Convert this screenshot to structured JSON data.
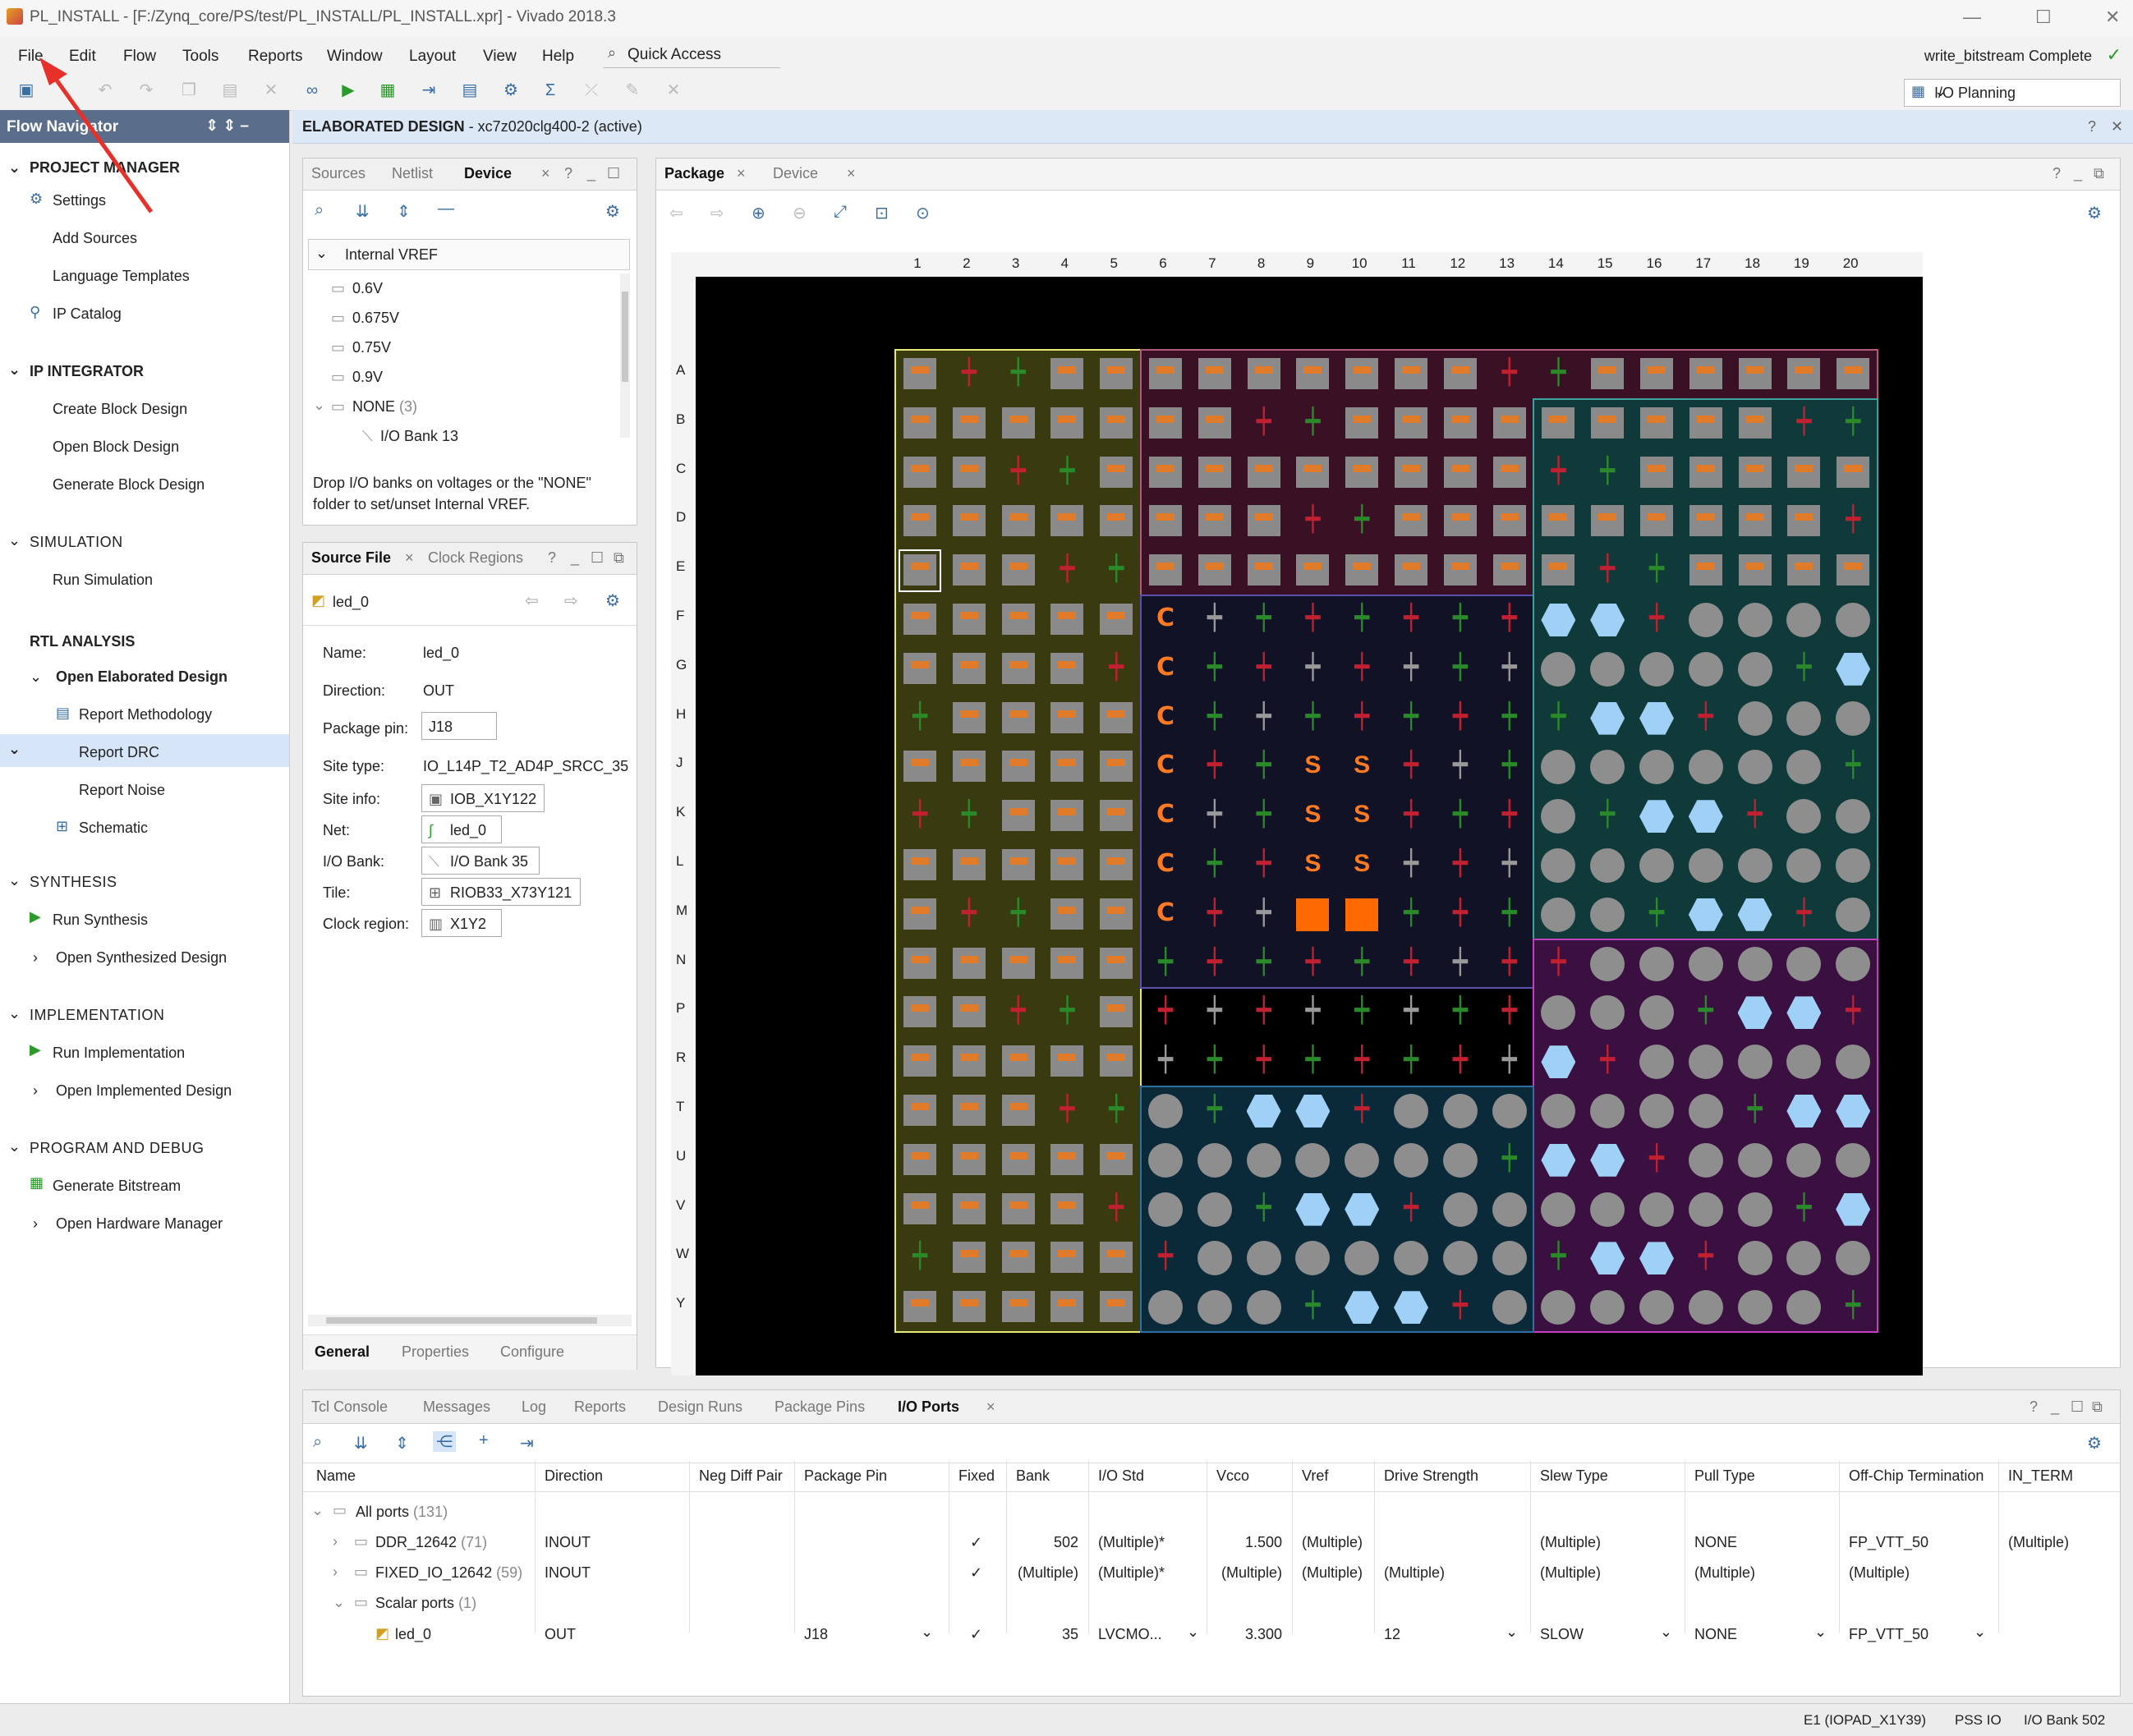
{
  "titlebar": {
    "title": "PL_INSTALL - [F:/Zynq_core/PS/test/PL_INSTALL/PL_INSTALL.xpr] - Vivado 2018.3",
    "min": "—",
    "max": "☐",
    "close": "✕"
  },
  "menubar": {
    "items": [
      "File",
      "Edit",
      "Flow",
      "Tools",
      "Reports",
      "Window",
      "Layout",
      "View",
      "Help"
    ],
    "quick_access": "Quick Access",
    "status": "write_bitstream Complete",
    "layout_select": "I/O Planning"
  },
  "flow_navigator": {
    "title": "Flow Navigator",
    "sections": [
      {
        "label": "PROJECT MANAGER",
        "items": [
          "Settings",
          "Add Sources",
          "Language Templates",
          "IP Catalog"
        ]
      },
      {
        "label": "IP INTEGRATOR",
        "items": [
          "Create Block Design",
          "Open Block Design",
          "Generate Block Design"
        ]
      },
      {
        "label": "SIMULATION",
        "items": [
          "Run Simulation"
        ]
      },
      {
        "label": "RTL ANALYSIS",
        "items": [
          "Open Elaborated Design",
          "Report Methodology",
          "Report DRC",
          "Report Noise",
          "Schematic"
        ]
      },
      {
        "label": "SYNTHESIS",
        "items": [
          "Run Synthesis",
          "Open Synthesized Design"
        ]
      },
      {
        "label": "IMPLEMENTATION",
        "items": [
          "Run Implementation",
          "Open Implemented Design"
        ]
      },
      {
        "label": "PROGRAM AND DEBUG",
        "items": [
          "Generate Bitstream",
          "Open Hardware Manager"
        ]
      }
    ]
  },
  "main_header": {
    "label": "ELABORATED DESIGN",
    "part": " - xc7z020clg400-2",
    "active": "(active)"
  },
  "device_panel": {
    "tabs": [
      "Sources",
      "Netlist",
      "Device"
    ],
    "tree_root": "Internal VREF",
    "voltages": [
      "0.6V",
      "0.675V",
      "0.75V",
      "0.9V"
    ],
    "none_folder": "NONE",
    "none_count": "(3)",
    "bank": "I/O Bank 13",
    "hint": "Drop I/O banks on voltages or the \"NONE\" folder to set/unset Internal VREF."
  },
  "source_panel": {
    "tabs": [
      "Source File",
      "Clock Regions"
    ],
    "object": "led_0",
    "rows": [
      {
        "label": "Name:",
        "value": "led_0"
      },
      {
        "label": "Direction:",
        "value": "OUT"
      },
      {
        "label": "Package pin:",
        "value": "J18"
      },
      {
        "label": "Site type:",
        "value": "IO_L14P_T2_AD4P_SRCC_35"
      },
      {
        "label": "Site info:",
        "value": "IOB_X1Y122"
      },
      {
        "label": "Net:",
        "value": "led_0"
      },
      {
        "label": "I/O Bank:",
        "value": "I/O Bank 35"
      },
      {
        "label": "Tile:",
        "value": "RIOB33_X73Y121"
      },
      {
        "label": "Clock region:",
        "value": "X1Y2"
      }
    ],
    "bottom_tabs": [
      "General",
      "Properties",
      "Configure"
    ]
  },
  "package_panel": {
    "tabs": [
      "Package",
      "Device"
    ],
    "columns": [
      "1",
      "2",
      "3",
      "4",
      "5",
      "6",
      "7",
      "8",
      "9",
      "10",
      "11",
      "12",
      "13",
      "14",
      "15",
      "16",
      "17",
      "18",
      "19",
      "20"
    ],
    "rows": [
      "A",
      "B",
      "C",
      "D",
      "E",
      "F",
      "G",
      "H",
      "J",
      "K",
      "L",
      "M",
      "N",
      "P",
      "R",
      "T",
      "U",
      "V",
      "W",
      "Y"
    ]
  },
  "io_ports": {
    "tabs": [
      "Tcl Console",
      "Messages",
      "Log",
      "Reports",
      "Design Runs",
      "Package Pins",
      "I/O Ports"
    ],
    "headers": [
      "Name",
      "Direction",
      "Neg Diff Pair",
      "Package Pin",
      "Fixed",
      "Bank",
      "I/O Std",
      "Vcco",
      "Vref",
      "Drive Strength",
      "Slew Type",
      "Pull Type",
      "Off-Chip Termination",
      "IN_TERM"
    ],
    "all_ports": "All ports",
    "all_count": "(131)",
    "rows": [
      {
        "name": "DDR_12642",
        "count": "(71)",
        "dir": "INOUT",
        "pin": "",
        "fixed": "✓",
        "bank": "502",
        "iostd": "(Multiple)*",
        "vcco": "1.500",
        "vref": "(Multiple)",
        "drive": "",
        "slew": "(Multiple)",
        "pull": "NONE",
        "term": "FP_VTT_50",
        "interm": "(Multiple)"
      },
      {
        "name": "FIXED_IO_12642",
        "count": "(59)",
        "dir": "INOUT",
        "pin": "",
        "fixed": "✓",
        "bank": "(Multiple)",
        "iostd": "(Multiple)*",
        "vcco": "(Multiple)",
        "vref": "(Multiple)",
        "drive": "(Multiple)",
        "slew": "(Multiple)",
        "pull": "(Multiple)",
        "term": "(Multiple)",
        "interm": ""
      }
    ],
    "scalar": "Scalar ports",
    "scalar_count": "(1)",
    "led": {
      "name": "led_0",
      "dir": "OUT",
      "pin": "J18",
      "fixed": "✓",
      "bank": "35",
      "iostd": "LVCMO...",
      "vcco": "3.300",
      "drive": "12",
      "slew": "SLOW",
      "pull": "NONE",
      "term": "FP_VTT_50"
    }
  },
  "statusbar": {
    "site": "E1 (IOPAD_X1Y39)",
    "type": "PSS IO",
    "bank": "I/O Bank 502"
  },
  "colors": {
    "accent": "#3a6ea5",
    "arrow": "#e8302a",
    "nav_header": "#5a6e8c"
  }
}
